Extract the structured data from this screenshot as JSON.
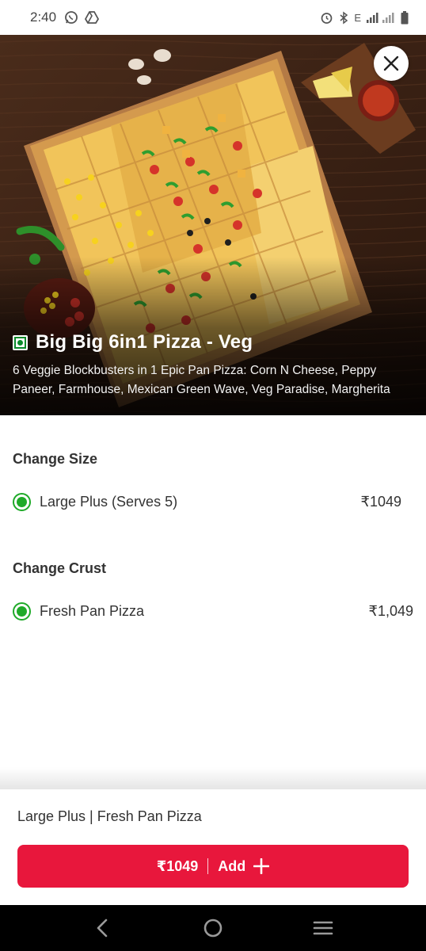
{
  "status_bar": {
    "time": "2:40",
    "icons": [
      "whatsapp-icon",
      "drive-icon",
      "alarm-icon",
      "bluetooth-icon",
      "signal-icon",
      "battery-icon"
    ],
    "network": "E"
  },
  "product": {
    "title": "Big Big 6in1 Pizza - Veg",
    "description": "6 Veggie Blockbusters in 1 Epic Pan Pizza: Corn N Cheese, Peppy Paneer, Farmhouse, Mexican Green Wave, Veg Paradise, Margherita",
    "veg_color": "#0a8a2a"
  },
  "size_section": {
    "title": "Change Size",
    "option": {
      "label": "Large Plus (Serves 5)",
      "price": "₹1049",
      "selected": true
    }
  },
  "crust_section": {
    "title": "Change Crust",
    "option": {
      "label": "Fresh Pan Pizza",
      "price": "₹1,049",
      "selected": true
    }
  },
  "footer": {
    "summary": "Large Plus | Fresh Pan Pizza",
    "button_price": "₹1049",
    "button_label": "Add"
  },
  "colors": {
    "accent_red": "#e8173c",
    "radio_green": "#1faa29"
  }
}
